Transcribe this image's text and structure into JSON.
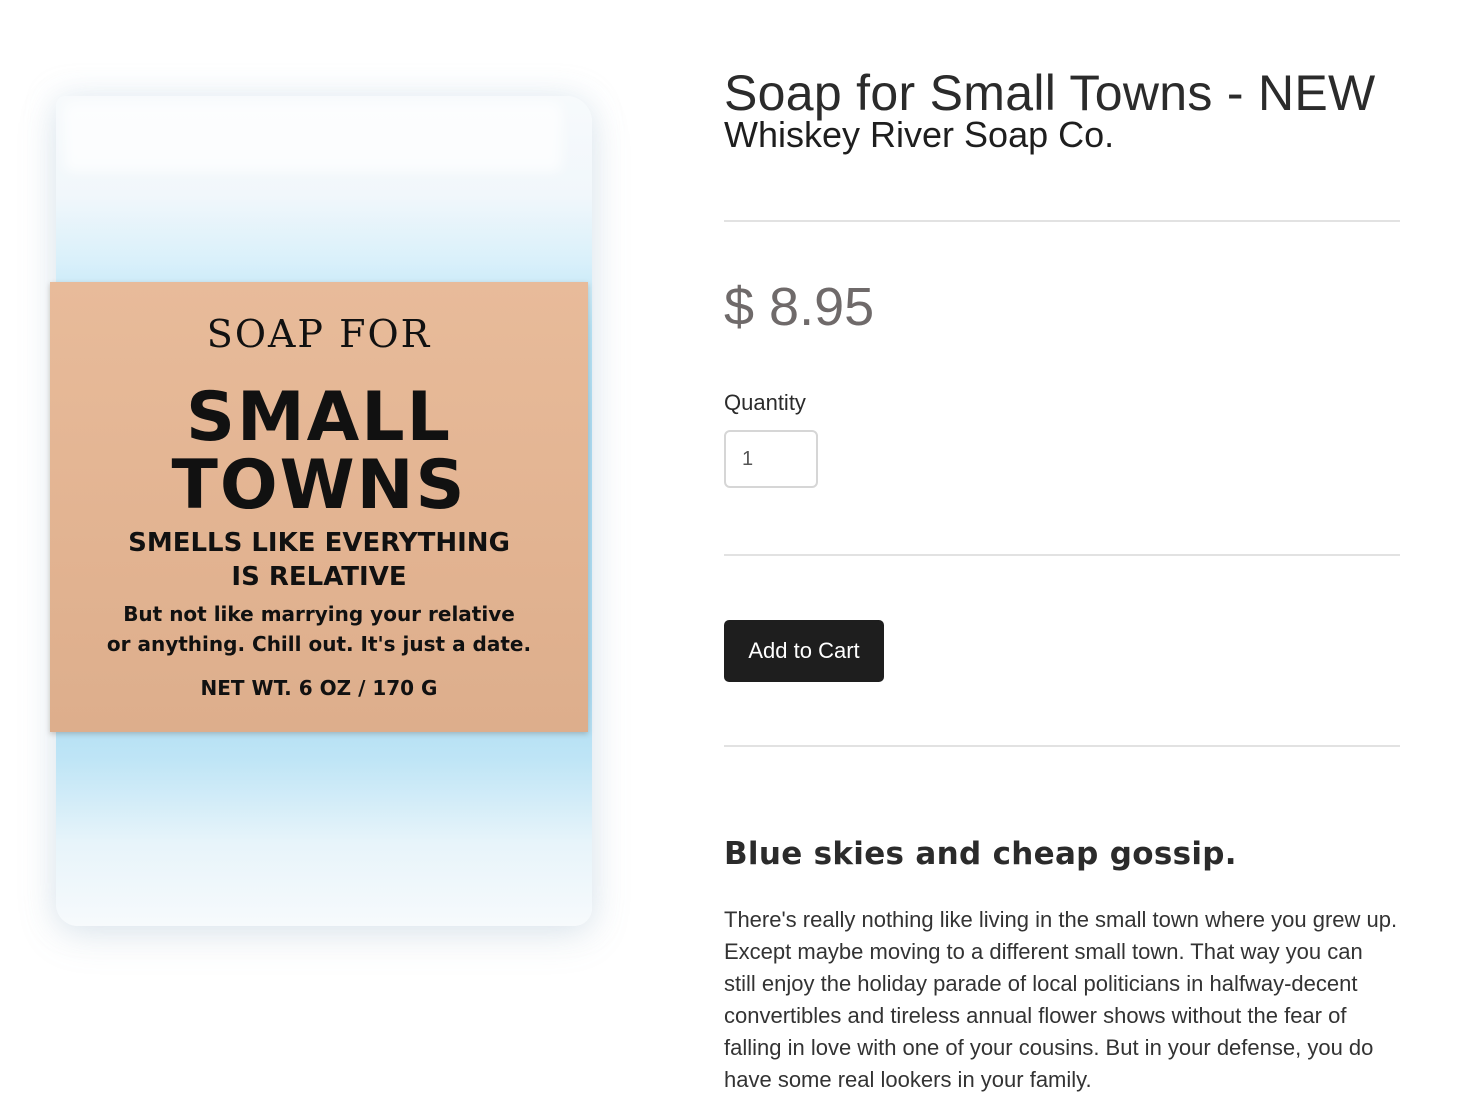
{
  "product_image": {
    "alt": "Soap for Small Towns",
    "label": {
      "line1": "SOAP FOR",
      "line2": "SMALL",
      "line3": "TOWNS",
      "line4": "SMELLS LIKE EVERYTHING",
      "line5": "IS RELATIVE",
      "line6": "But not like marrying your relative",
      "line7": "or anything. Chill out. It's just a date.",
      "line8": "NET WT. 6 OZ / 170 G"
    },
    "colors": {
      "soap": "#aadbf1",
      "label": "#e4b695"
    }
  },
  "product": {
    "title": "Soap for Small Towns - NEW",
    "vendor": "Whiskey River Soap Co.",
    "price": "$ 8.95",
    "quantity_label": "Quantity",
    "quantity_value": "1",
    "add_to_cart_label": "Add to Cart",
    "tagline": "Blue skies and cheap gossip.",
    "description": "There's really nothing like living in the small town where you grew up. Except maybe moving to a different small town. That way you can still enjoy the holiday parade of local politicians in halfway-decent convertibles and tireless annual flower shows without the fear of falling in love with one of your cousins. But in your defense, you do have some real lookers in your family."
  },
  "colors": {
    "button_bg": "#1e1e1e",
    "price_text": "#6f6a6a",
    "divider": "#e2e2e2"
  }
}
